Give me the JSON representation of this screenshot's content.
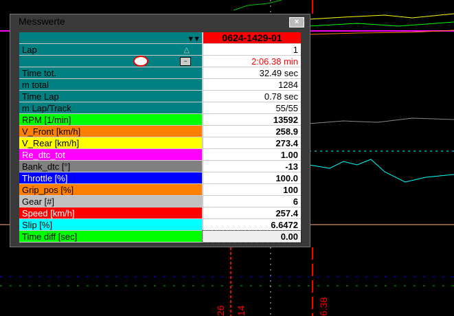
{
  "window": {
    "title": "Messwerte",
    "close": "×"
  },
  "header": {
    "session": "0624-1429-01",
    "session_bg": "#ff0000"
  },
  "rows": [
    {
      "label": "Lap",
      "value": "1",
      "bg": "#008080",
      "fg": "#000",
      "bold": false,
      "icon": "triangle-up-icon"
    },
    {
      "label": "",
      "value": "2:06.38 min",
      "bg": "#008080",
      "fg": "#000",
      "bold": false,
      "value_color": "#ff0000",
      "icon": "stopwatch-icon"
    },
    {
      "label": "Time tot.",
      "value": "32.49 sec",
      "bg": "#008080",
      "fg": "#000",
      "bold": false
    },
    {
      "label": "m total",
      "value": "1284",
      "bg": "#008080",
      "fg": "#000",
      "bold": false
    },
    {
      "label": "Time Lap",
      "value": "0.78 sec",
      "bg": "#008080",
      "fg": "#000",
      "bold": false
    },
    {
      "label": "m Lap/Track",
      "value": "55/55",
      "bg": "#008080",
      "fg": "#000",
      "bold": false
    },
    {
      "label": "RPM [1/min]",
      "value": "13592",
      "bg": "#00ff00",
      "fg": "#000",
      "bold": true
    },
    {
      "label": "V_Front [km/h]",
      "value": "258.9",
      "bg": "#ff8000",
      "fg": "#000",
      "bold": true
    },
    {
      "label": "V_Rear [km/h]",
      "value": "273.4",
      "bg": "#ffff00",
      "fg": "#000",
      "bold": true
    },
    {
      "label": "Re_dtc_tot",
      "value": "1.00",
      "bg": "#ff00ff",
      "fg": "#fff",
      "bold": true
    },
    {
      "label": "Bank_dtc [°]",
      "value": "-13",
      "bg": "#808080",
      "fg": "#000",
      "bold": true
    },
    {
      "label": "Throttle [%]",
      "value": "100.0",
      "bg": "#0000ff",
      "fg": "#fff",
      "bold": true
    },
    {
      "label": "Grip_pos [%]",
      "value": "100",
      "bg": "#ff8000",
      "fg": "#000",
      "bold": true
    },
    {
      "label": "Gear [#]",
      "value": "6",
      "bg": "#c0c0c0",
      "fg": "#000",
      "bold": true
    },
    {
      "label": "Speed [km/h]",
      "value": "257.4",
      "bg": "#ff0000",
      "fg": "#fff",
      "bold": true
    },
    {
      "label": "Slip [%]",
      "value": "6.6472",
      "bg": "#00ffff",
      "fg": "#000",
      "bold": true
    },
    {
      "label": "Time diff [sec]",
      "value": "0.00",
      "bg": "#00ff00",
      "fg": "#000",
      "bold": true
    }
  ],
  "axis_labels": [
    "26",
    "14",
    "6.38"
  ]
}
